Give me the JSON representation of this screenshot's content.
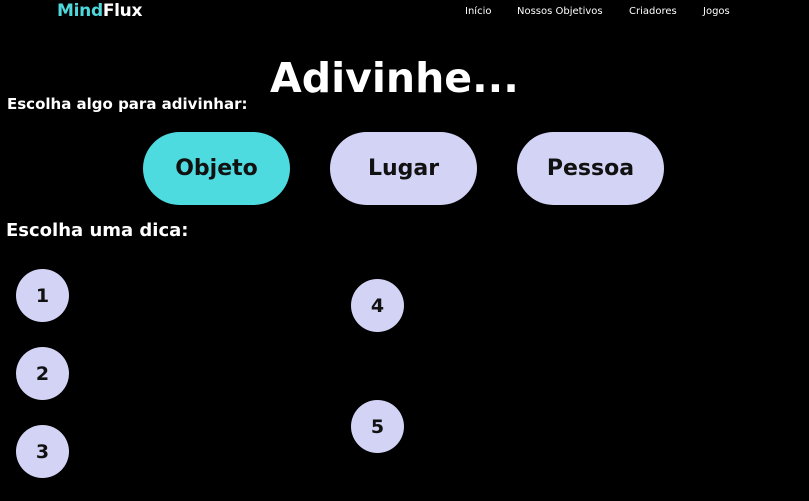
{
  "header": {
    "logo_part1": "Mind",
    "logo_part2": "Flux",
    "nav": [
      "Início",
      "Nossos Objetivos",
      "Criadores",
      "Jogos"
    ]
  },
  "main": {
    "title": "Adivinhe...",
    "category_prompt": "Escolha algo para adivinhar:",
    "categories": [
      {
        "label": "Objeto",
        "selected": true
      },
      {
        "label": "Lugar",
        "selected": false
      },
      {
        "label": "Pessoa",
        "selected": false
      }
    ],
    "hint_prompt": "Escolha uma dica:",
    "hints": [
      "1",
      "2",
      "3",
      "4",
      "5"
    ]
  },
  "colors": {
    "background": "#000000",
    "brand_accent": "#4fd8dc",
    "button_default": "#d3d3f5",
    "button_selected": "#4ddbe0"
  }
}
